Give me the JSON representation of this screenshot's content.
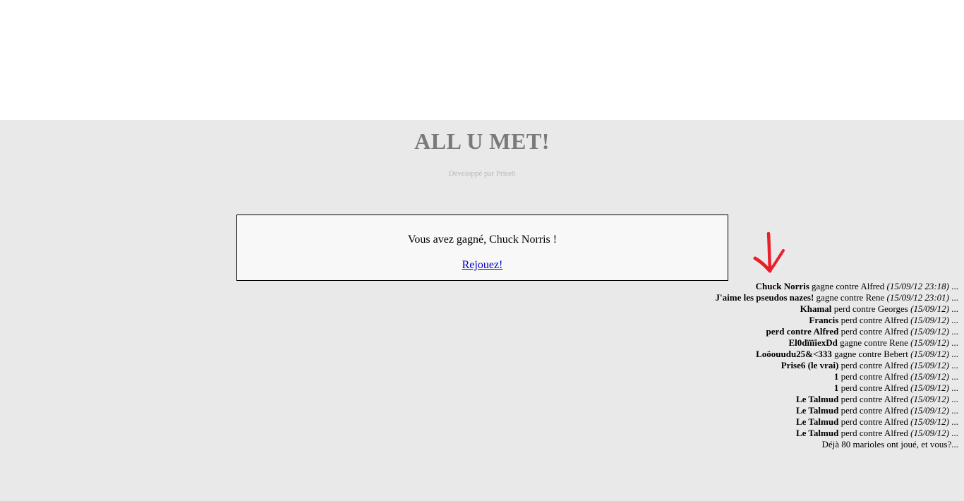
{
  "header": {
    "title": "ALL U MET!",
    "subtitle": "Developpé par Prise6"
  },
  "result": {
    "message": "Vous avez gagné, Chuck Norris !",
    "replay_label": "Rejouez!"
  },
  "icons": {
    "arrow": "red-down-arrow-icon",
    "arrow_color": "#e8202a"
  },
  "history": {
    "rows": [
      {
        "name": "Chuck Norris",
        "action": " gagne contre Alfred ",
        "date": "(15/09/12 23:18)",
        "suffix": " ..."
      },
      {
        "name": "J'aime les pseudos nazes!",
        "action": " gagne contre Rene ",
        "date": "(15/09/12 23:01)",
        "suffix": " ..."
      },
      {
        "name": "Khamal",
        "action": " perd contre Georges ",
        "date": "(15/09/12)",
        "suffix": " ..."
      },
      {
        "name": "Francis",
        "action": " perd contre Alfred ",
        "date": "(15/09/12)",
        "suffix": " ..."
      },
      {
        "name": "perd contre Alfred",
        "action": " perd contre Alfred ",
        "date": "(15/09/12)",
        "suffix": " ..."
      },
      {
        "name": "El0dïïïiexDd",
        "action": " gagne contre Rene ",
        "date": "(15/09/12)",
        "suffix": " ..."
      },
      {
        "name": "Loöouudu25&<333",
        "action": " gagne contre Bebert ",
        "date": "(15/09/12)",
        "suffix": " ..."
      },
      {
        "name": "Prise6 (le vrai)",
        "action": " perd contre Alfred ",
        "date": "(15/09/12)",
        "suffix": " ..."
      },
      {
        "name": "1",
        "action": " perd contre Alfred ",
        "date": "(15/09/12)",
        "suffix": " ..."
      },
      {
        "name": "1",
        "action": " perd contre Alfred ",
        "date": "(15/09/12)",
        "suffix": " ..."
      },
      {
        "name": "Le Talmud",
        "action": " perd contre Alfred ",
        "date": "(15/09/12)",
        "suffix": " ..."
      },
      {
        "name": "Le Talmud",
        "action": " perd contre Alfred ",
        "date": "(15/09/12)",
        "suffix": " ..."
      },
      {
        "name": "Le Talmud",
        "action": " perd contre Alfred ",
        "date": "(15/09/12)",
        "suffix": " ..."
      },
      {
        "name": "Le Talmud",
        "action": " perd contre Alfred ",
        "date": "(15/09/12)",
        "suffix": " ..."
      }
    ],
    "footer": "Déjà 80 marioles ont joué, et vous?..."
  }
}
